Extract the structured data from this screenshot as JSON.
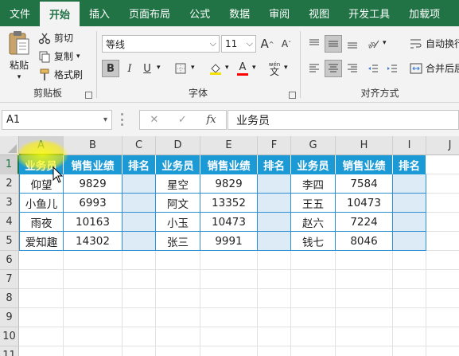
{
  "tabs": [
    "文件",
    "开始",
    "插入",
    "页面布局",
    "公式",
    "数据",
    "审阅",
    "视图",
    "开发工具",
    "加载项"
  ],
  "active_tab": 1,
  "clipboard": {
    "paste": "粘贴",
    "cut": "剪切",
    "copy": "复制",
    "format_painter": "格式刷",
    "group_label": "剪贴板"
  },
  "font": {
    "name": "等线",
    "size": "11",
    "grow": "A",
    "shrink": "A",
    "bold": "B",
    "italic": "I",
    "underline": "U",
    "fill_color_char": "A",
    "wen": "wén",
    "wen_char": "文",
    "group_label": "字体"
  },
  "align": {
    "wrap_text": "自动换行",
    "merge_center": "合并后居",
    "group_label": "对齐方式"
  },
  "formula_bar": {
    "name_box": "A1",
    "cancel": "✕",
    "confirm": "✓",
    "fx": "fx",
    "content": "业务员"
  },
  "columns": [
    "A",
    "B",
    "C",
    "D",
    "E",
    "F",
    "G",
    "H",
    "I",
    "J"
  ],
  "rows": [
    "1",
    "2",
    "3",
    "4",
    "5",
    "6",
    "7",
    "8",
    "9",
    "10",
    "11"
  ],
  "table": {
    "headers": [
      "业务员",
      "销售业绩",
      "排名",
      "业务员",
      "销售业绩",
      "排名",
      "业务员",
      "销售业绩",
      "排名"
    ],
    "data": [
      [
        "仰望",
        "9829",
        "",
        "星空",
        "9829",
        "",
        "李四",
        "7584",
        ""
      ],
      [
        "小鱼儿",
        "6993",
        "",
        "阿文",
        "13352",
        "",
        "王五",
        "10473",
        ""
      ],
      [
        "雨夜",
        "10163",
        "",
        "小玉",
        "10473",
        "",
        "赵六",
        "7224",
        ""
      ],
      [
        "爱知趣",
        "14302",
        "",
        "张三",
        "9991",
        "",
        "钱七",
        "8046",
        ""
      ]
    ]
  },
  "colors": {
    "ribbon_green": "#217346",
    "header_blue": "#1b9ad6",
    "rank_fill": "#ddebf7"
  }
}
